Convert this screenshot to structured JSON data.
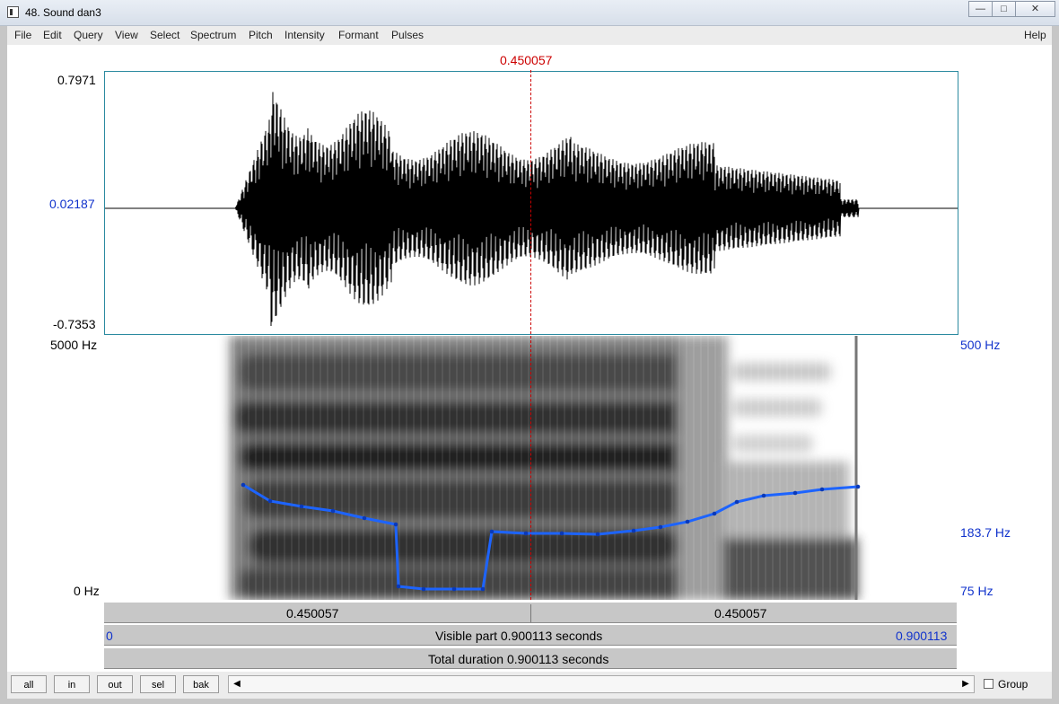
{
  "window": {
    "title": "48. Sound dan3",
    "controls": [
      "minimize-icon",
      "maximize-icon",
      "close-icon"
    ]
  },
  "menu": {
    "items": [
      "File",
      "Edit",
      "Query",
      "View",
      "Select",
      "Spectrum",
      "Pitch",
      "Intensity",
      "Formant",
      "Pulses"
    ],
    "help": "Help"
  },
  "cursor": {
    "time_label": "0.450057"
  },
  "waveform": {
    "max_label": "0.7971",
    "mid_label": "0.02187",
    "min_label": "-0.7353"
  },
  "spectrogram": {
    "freq_top": "5000 Hz",
    "freq_bottom": "0 Hz",
    "pitch_top": "500 Hz",
    "pitch_mid": "183.7 Hz",
    "pitch_bottom": "75 Hz"
  },
  "time_rows": {
    "left_segment": "0.450057",
    "right_segment": "0.450057",
    "visible_start": "0",
    "visible_label": "Visible part 0.900113 seconds",
    "visible_end": "0.900113",
    "total_label": "Total duration 0.900113 seconds"
  },
  "toolbar": {
    "buttons": [
      "all",
      "in",
      "out",
      "sel",
      "bak"
    ],
    "group_label": "Group",
    "arrows": [
      "left-arrow-icon",
      "right-arrow-icon"
    ]
  },
  "colors": {
    "cursor": "#cc0000",
    "axis_blue": "#1133cc",
    "pitch_line": "#1d64ff"
  }
}
